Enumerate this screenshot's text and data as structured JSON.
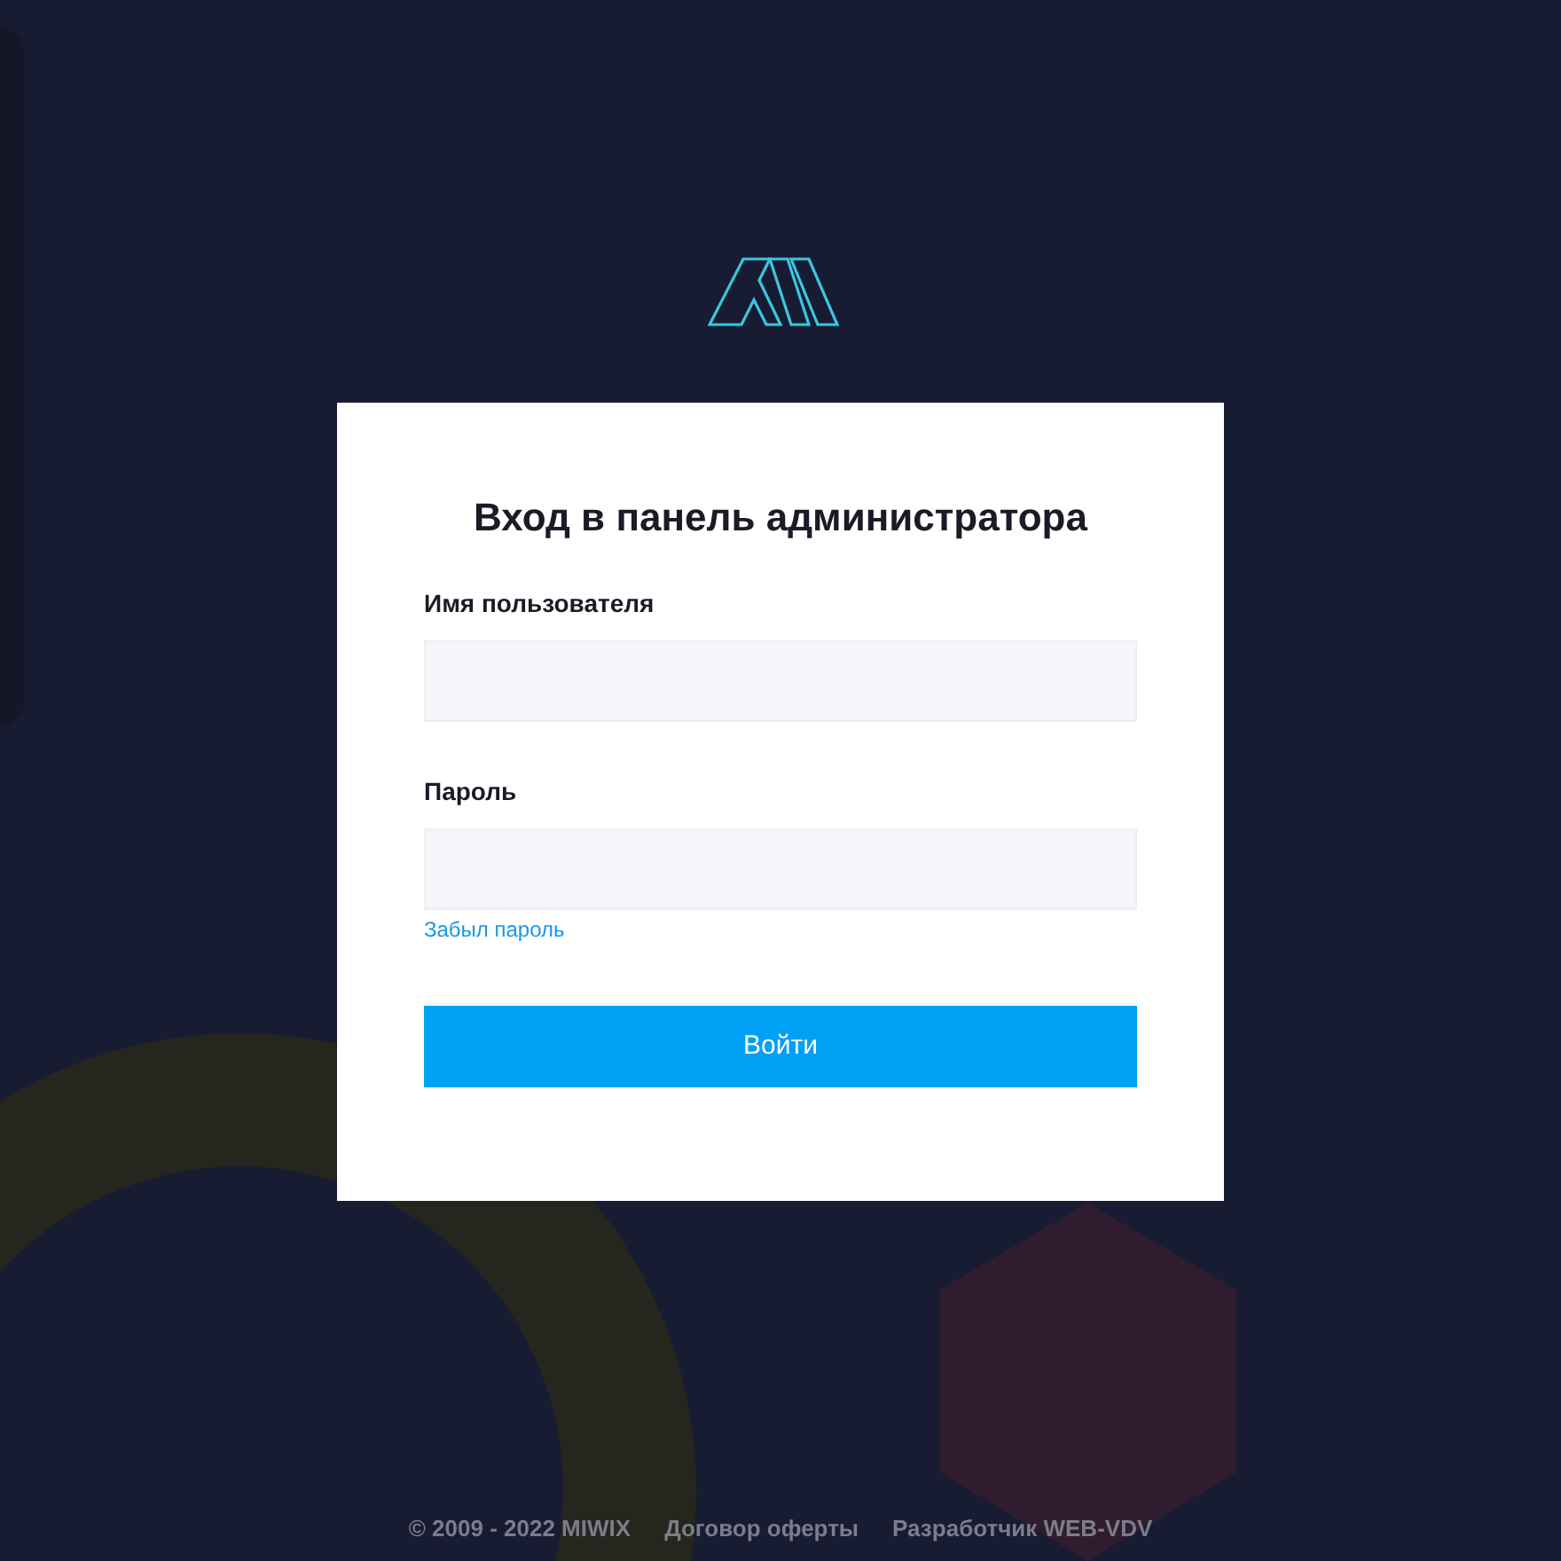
{
  "login_form": {
    "title": "Вход в панель администратора",
    "fields": [
      {
        "label": "Имя пользователя"
      },
      {
        "label": "Пароль"
      }
    ],
    "forgot_link": "Забыл пароль",
    "submit_button": "Войти"
  },
  "footer": {
    "copyright": "© 2009 - 2022 MIWIX",
    "links": [
      "Договор оферты",
      "Разработчик WEB-VDV"
    ]
  }
}
